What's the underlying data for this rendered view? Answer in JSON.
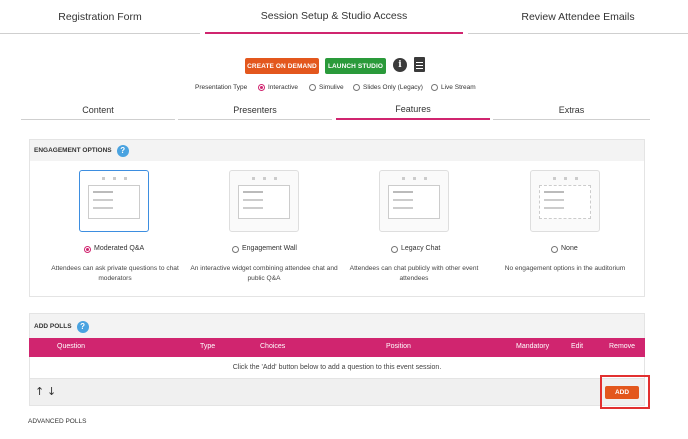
{
  "steps": [
    "Registration Form",
    "Session Setup & Studio Access",
    "Review Attendee Emails"
  ],
  "actions": {
    "create_on_demand": "CREATE ON DEMAND",
    "launch_studio": "LAUNCH STUDIO",
    "info_icon_glyph": "i"
  },
  "presentation_type": {
    "label": "Presentation Type",
    "options": [
      "Interactive",
      "Simulive",
      "Slides Only (Legacy)",
      "Live Stream"
    ],
    "selected": "Interactive"
  },
  "subtabs": [
    "Content",
    "Presenters",
    "Features",
    "Extras"
  ],
  "active_subtab": "Features",
  "engagement": {
    "title": "ENGAGEMENT OPTIONS",
    "help_glyph": "?",
    "options": [
      {
        "label": "Moderated Q&A",
        "desc": "Attendees can ask private questions to chat moderators",
        "selected": true
      },
      {
        "label": "Engagement Wall",
        "desc": "An interactive widget combining attendee chat and public Q&A",
        "selected": false
      },
      {
        "label": "Legacy Chat",
        "desc": "Attendees can chat publicly with other event attendees",
        "selected": false
      },
      {
        "label": "None",
        "desc": "No engagement options in the auditorium",
        "selected": false
      }
    ]
  },
  "polls": {
    "title": "ADD POLLS",
    "help_glyph": "?",
    "columns": [
      "Question",
      "Type",
      "Choices",
      "Position",
      "Mandatory",
      "Edit",
      "Remove"
    ],
    "empty_message": "Click the 'Add' button below to add a question to this event session.",
    "up_arrow": "↑",
    "down_arrow": "↓",
    "add_label": "ADD"
  },
  "advanced_polls": "ADVANCED POLLS",
  "colors": {
    "accent": "#d0256f",
    "orange": "#e3571d",
    "green": "#2a9a3a",
    "help_blue": "#4aa3e0",
    "highlight_red": "#e23030"
  }
}
